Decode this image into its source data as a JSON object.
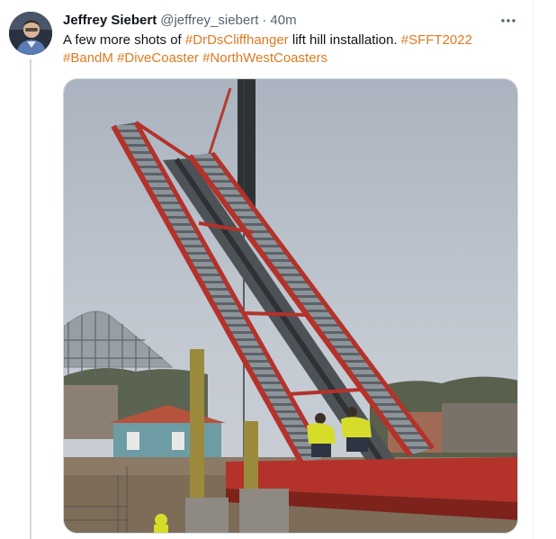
{
  "tweet": {
    "author": {
      "display_name": "Jeffrey Siebert",
      "handle": "@jeffrey_siebert",
      "separator": "·",
      "timestamp": "40m"
    },
    "more_icon": "ellipsis-icon",
    "text_segments": [
      {
        "type": "text",
        "value": "A few more shots of "
      },
      {
        "type": "hashtag",
        "value": "#DrDsCliffhanger"
      },
      {
        "type": "text",
        "value": " lift hill installation. "
      },
      {
        "type": "hashtag",
        "value": "#SFFT2022"
      },
      {
        "type": "text",
        "value": " "
      },
      {
        "type": "hashtag",
        "value": "#BandM"
      },
      {
        "type": "text",
        "value": " "
      },
      {
        "type": "hashtag",
        "value": "#DiveCoaster"
      },
      {
        "type": "text",
        "value": " "
      },
      {
        "type": "hashtag",
        "value": "#NorthWestCoasters"
      }
    ],
    "colors": {
      "text": "#0f1419",
      "secondary": "#536471",
      "hashtag": "#e07a1f",
      "thread_line": "#cfd9de"
    }
  }
}
